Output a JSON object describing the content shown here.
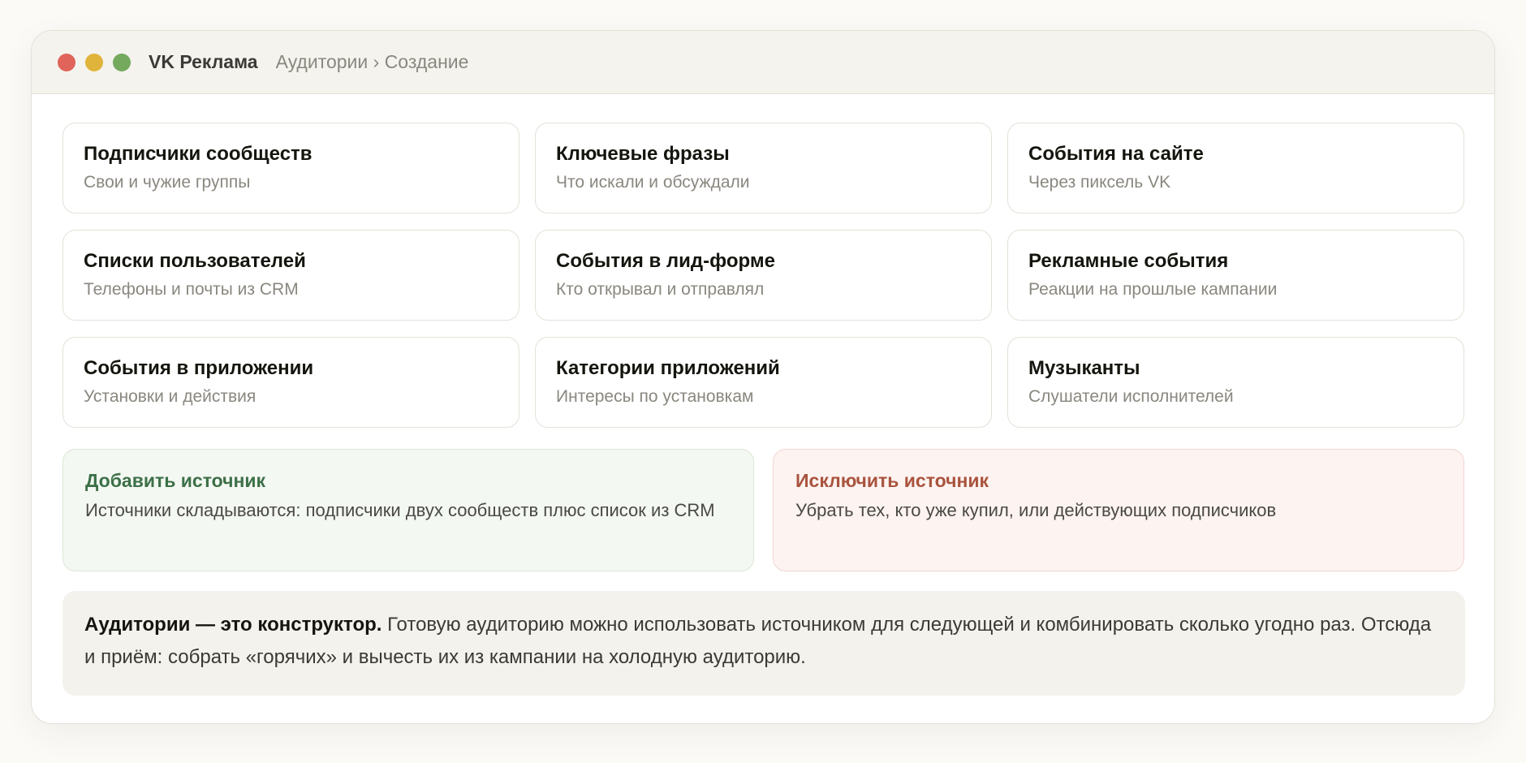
{
  "window": {
    "app_title": "VK Реклама",
    "breadcrumb": "Аудитории › Создание"
  },
  "sources": [
    {
      "title": "Подписчики сообществ",
      "subtitle": "Свои и чужие группы"
    },
    {
      "title": "Ключевые фразы",
      "subtitle": "Что искали и обсуждали"
    },
    {
      "title": "События на сайте",
      "subtitle": "Через пиксель VK"
    },
    {
      "title": "Списки пользователей",
      "subtitle": "Телефоны и почты из CRM"
    },
    {
      "title": "События в лид-форме",
      "subtitle": "Кто открывал и отправлял"
    },
    {
      "title": "Рекламные события",
      "subtitle": "Реакции на прошлые кампании"
    },
    {
      "title": "События в приложении",
      "subtitle": "Установки и действия"
    },
    {
      "title": "Категории приложений",
      "subtitle": "Интересы по установкам"
    },
    {
      "title": "Музыканты",
      "subtitle": "Слушатели исполнителей"
    }
  ],
  "actions": {
    "add": {
      "title": "Добавить источник",
      "description": "Источники складываются: подписчики двух сообществ плюс список из CRM"
    },
    "exclude": {
      "title": "Исключить источник",
      "description": "Убрать тех, кто уже купил, или действующих подписчиков"
    }
  },
  "note": {
    "lead": "Аудитории — это конструктор.",
    "text": " Готовую аудиторию можно использовать источником для следующей и комбинировать сколько угодно раз. Отсюда и приём: собрать «горячих» и вычесть их из кампании на холодную аудиторию."
  },
  "colors": {
    "close_dot": "#e06459",
    "minimize_dot": "#e0b33b",
    "maximize_dot": "#74a95e",
    "add_accent": "#3c7048",
    "exclude_accent": "#a9533d"
  }
}
